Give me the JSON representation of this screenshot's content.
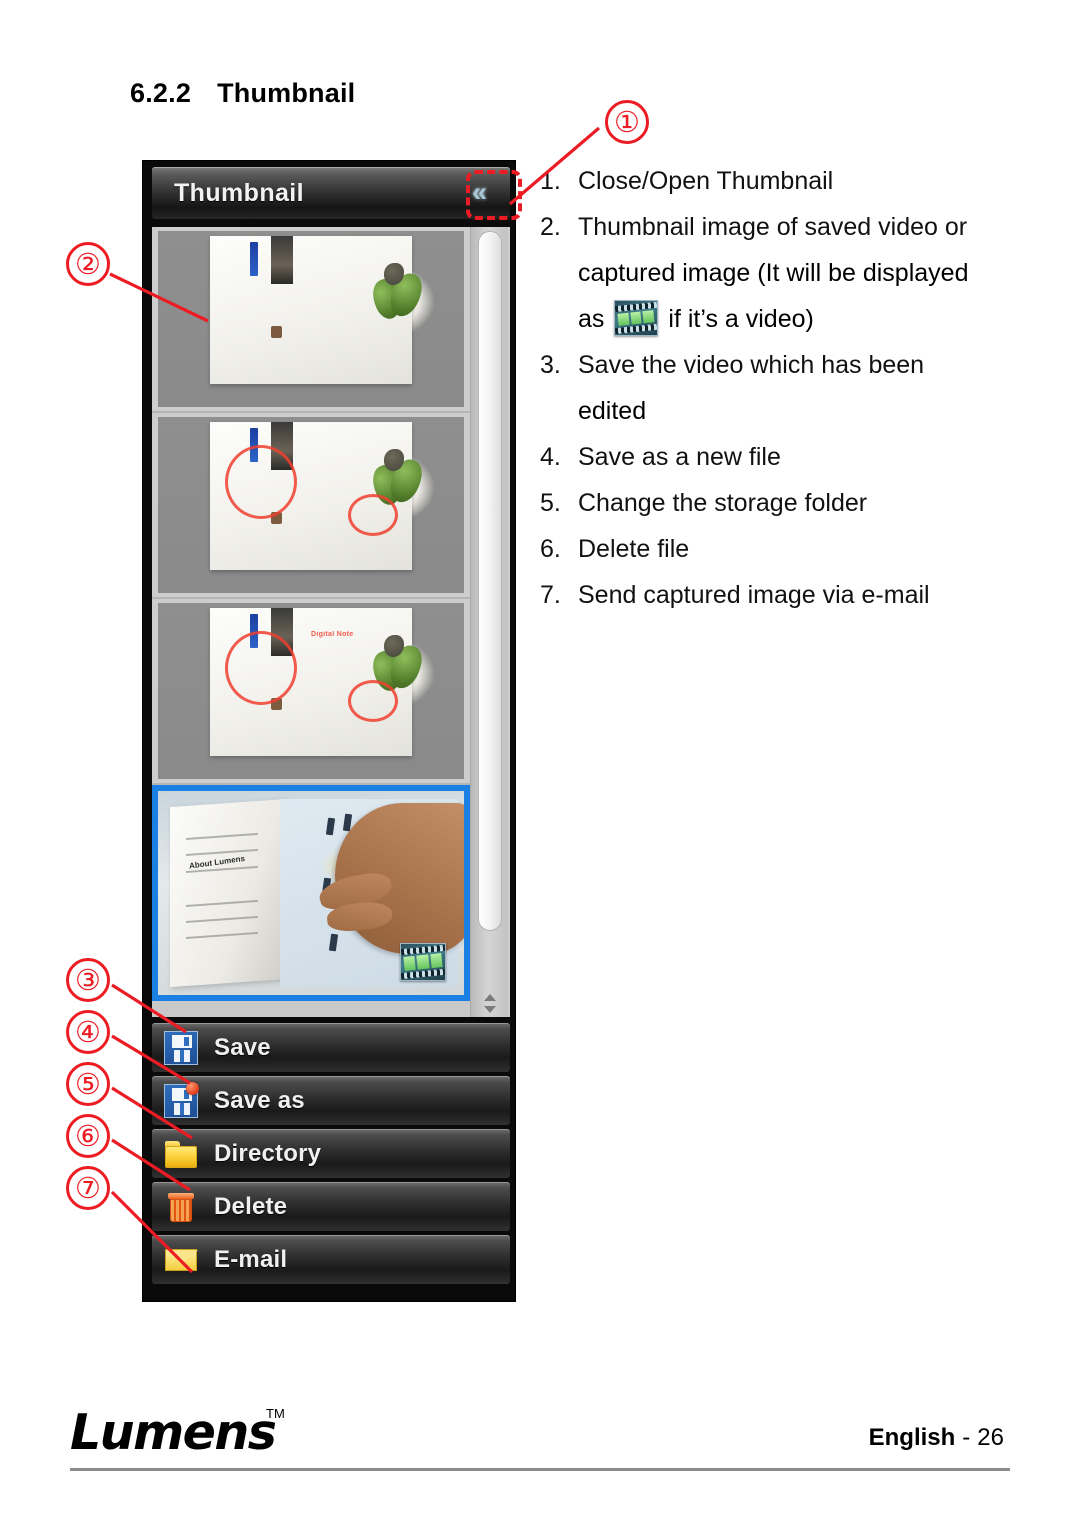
{
  "heading": {
    "number": "6.2.2",
    "title": "Thumbnail"
  },
  "panel": {
    "title": "Thumbnail",
    "collapse_icon": "double-chevron-left-icon",
    "collapse_glyph": "«",
    "accent_selected": "#1b80e3",
    "buttons": [
      {
        "label": "Save",
        "icon": "floppy-disk-icon"
      },
      {
        "label": "Save as",
        "icon": "floppy-disk-plus-icon"
      },
      {
        "label": "Directory",
        "icon": "folder-icon"
      },
      {
        "label": "Delete",
        "icon": "trash-can-icon"
      },
      {
        "label": "E-mail",
        "icon": "envelope-icon"
      }
    ],
    "thumbnails": [
      {
        "name": "thumbnail-1",
        "selected": false,
        "is_video": false
      },
      {
        "name": "thumbnail-2",
        "selected": false,
        "is_video": false
      },
      {
        "name": "thumbnail-3",
        "selected": false,
        "is_video": false
      },
      {
        "name": "thumbnail-4",
        "selected": true,
        "is_video": true
      }
    ],
    "thumbnail_annotation_text": "Digital Note"
  },
  "instructions": [
    {
      "num": "1.",
      "text": "Close/Open Thumbnail"
    },
    {
      "num": "2.",
      "text": "Thumbnail image of saved video or"
    },
    {
      "num": "3.",
      "text": "Save the video which has been"
    },
    {
      "num": "4.",
      "text": "Save as a new file"
    },
    {
      "num": "5.",
      "text": "Change the storage folder"
    },
    {
      "num": "6.",
      "text": "Delete file"
    },
    {
      "num": "7.",
      "text": "Send captured image via e-mail"
    }
  ],
  "continuations": {
    "item2_line2": "captured image (It will be displayed",
    "item2_line3_pre": "as",
    "item2_line3_post": "if it’s a video)",
    "item3_line2": "edited"
  },
  "callouts": [
    {
      "label": "①",
      "name": "callout-1"
    },
    {
      "label": "②",
      "name": "callout-2"
    },
    {
      "label": "③",
      "name": "callout-3"
    },
    {
      "label": "④",
      "name": "callout-4"
    },
    {
      "label": "⑤",
      "name": "callout-5"
    },
    {
      "label": "⑥",
      "name": "callout-6"
    },
    {
      "label": "⑦",
      "name": "callout-7"
    }
  ],
  "callout_color": "#ec1c24",
  "footer": {
    "brand": "Lumens",
    "trademark": "TM",
    "language": "English",
    "separator": "-",
    "page": "26"
  },
  "book_caption": "About Lumens"
}
